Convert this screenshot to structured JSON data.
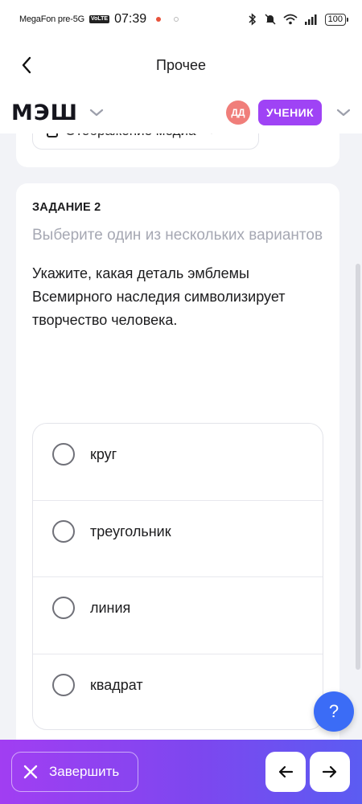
{
  "status_bar": {
    "carrier": "MegaFon pre-5G",
    "volte": "VoLTE",
    "time": "07:39",
    "battery": "100"
  },
  "header": {
    "title": "Прочее"
  },
  "app_bar": {
    "logo": "МЭШ",
    "avatar_initials": "ДД",
    "role": "УЧЕНИК"
  },
  "prev_card": {
    "media_toggle_label": "Отображение медиа"
  },
  "task": {
    "number_label": "ЗАДАНИЕ 2",
    "type_label": "Выберите один из нескольких вариантов",
    "question": "Укажите, какая деталь эмблемы Всемирного наследия символизирует творчество человека.",
    "options": [
      {
        "label": "круг",
        "selected": false
      },
      {
        "label": "треугольник",
        "selected": false
      },
      {
        "label": "линия",
        "selected": false
      },
      {
        "label": "квадрат",
        "selected": false
      }
    ]
  },
  "help": {
    "label": "?"
  },
  "bottom_bar": {
    "finish_label": "Завершить"
  },
  "colors": {
    "accent_purple": "#9f43f5",
    "help_blue": "#3b6cf6",
    "avatar_red": "#f07e7a"
  }
}
